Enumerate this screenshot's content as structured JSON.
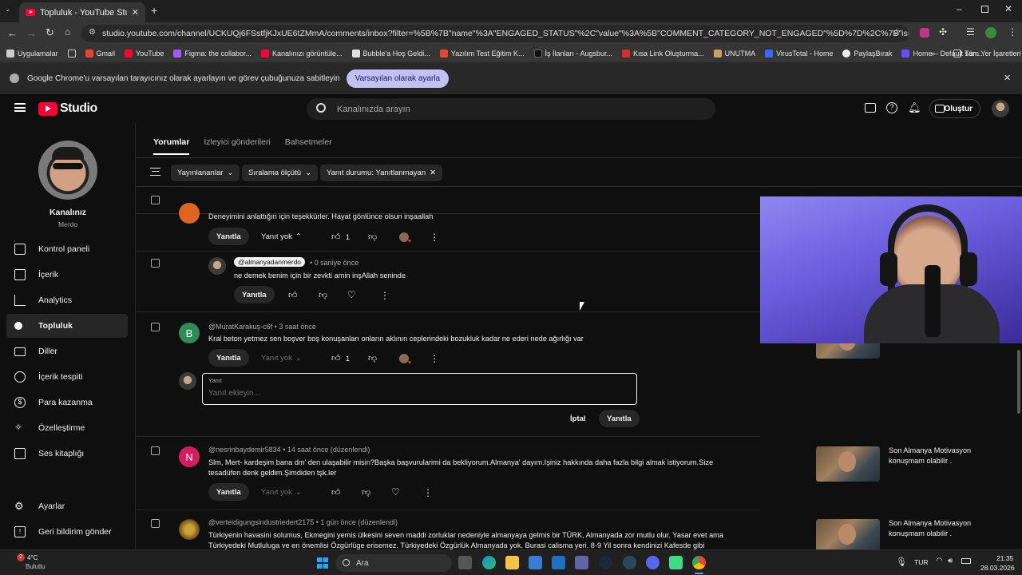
{
  "browser": {
    "tab_title": "Topluluk - YouTube Studio",
    "url": "studio.youtube.com/channel/UCKUQj6FSstfjKJxUE6tZMmA/comments/inbox?filter=%5B%7B\"name\"%3A\"ENGAGED_STATUS\"%2C\"value\"%3A%5B\"COMMENT_CATEGORY_NOT_ENGAGED\"%5D%7D%2C%7B\"isPinned\"%3Atrue%2C\"name\"...",
    "bookmarks": [
      {
        "label": "Uygulamalar",
        "color": "#e0e0e0"
      },
      {
        "label": "Gmail",
        "color": "#ea4335"
      },
      {
        "label": "YouTube",
        "color": "#ff0033"
      },
      {
        "label": "Figma: the collabor...",
        "color": "#a259ff"
      },
      {
        "label": "Kanalınızı görüntüle...",
        "color": "#ff0033"
      },
      {
        "label": "Bubble'a Hoş Geldi...",
        "color": "#e0e0e0"
      },
      {
        "label": "Yazılım Test Eğitim K...",
        "color": "#e34a2f"
      },
      {
        "label": "İş İlanları - Augsbur...",
        "color": "#1a1a1a"
      },
      {
        "label": "Kısa Link Oluşturma...",
        "color": "#d32f2f"
      },
      {
        "label": "UNUTMA",
        "color": "#c8a165"
      },
      {
        "label": "VirusTotal - Home",
        "color": "#3a66ff"
      },
      {
        "label": "PaylaşBırak",
        "color": "#f0f0f0"
      },
      {
        "label": "Home – Default san...",
        "color": "#6a4cff"
      }
    ],
    "bookmarks_all": "Tüm Yer İşaretleri",
    "infobar_text": "Google Chrome'u varsayılan tarayıcınız olarak ayarlayın ve görev çubuğunuza sabitleyin",
    "infobar_button": "Varsayılan olarak ayarla"
  },
  "studio": {
    "logo": "Studio",
    "search_placeholder": "Kanalınızda arayın",
    "create_label": "Oluştur",
    "channel_title": "Kanalınız",
    "channel_name": "Merdo",
    "nav": [
      {
        "label": "Kontrol paneli",
        "icon": "dashboard-icon"
      },
      {
        "label": "İçerik",
        "icon": "content-icon"
      },
      {
        "label": "Analytics",
        "icon": "analytics-icon"
      },
      {
        "label": "Topluluk",
        "icon": "community-icon"
      },
      {
        "label": "Diller",
        "icon": "subtitles-icon"
      },
      {
        "label": "İçerik tespiti",
        "icon": "copyright-icon"
      },
      {
        "label": "Para kazanma",
        "icon": "dollar-icon"
      },
      {
        "label": "Özelleştirme",
        "icon": "wand-icon"
      },
      {
        "label": "Ses kitaplığı",
        "icon": "audio-library-icon"
      }
    ],
    "settings_label": "Ayarlar",
    "feedback_label": "Geri bildirim gönder",
    "tabs": [
      "Yorumlar",
      "İzleyici gönderileri",
      "Bahsetmeler"
    ],
    "filters": [
      "Yayınlananlar",
      "Sıralama ölçütü",
      "Yanıt durumu: Yanıtlanmayan"
    ],
    "comments": {
      "c0_text": "Deneyimini anlattığın için teşekkürler. Hayat gönlünce olsun inşaallah",
      "c0_likes": "1",
      "reply_label": "Yanıtla",
      "no_reply_label": "Yanıt yok",
      "r1_author": "@almanyadanmerdo",
      "r1_time": "0 saniye önce",
      "r1_text": "ne demek benim için bir zevkti amin inşAllah seninde",
      "c2_initial": "B",
      "c2_author": "@MuratKarakuş-c6f",
      "c2_time": "3 saat önce",
      "c2_text": "Kral beton yetmez sen boşver boş konuşanları onların aklının ceplerindeki bozukluk kadar ne ederi nede ağırlığı var",
      "c2_likes": "1",
      "reply_box_label": "Yanıt",
      "reply_box_placeholder": "Yanıt ekleyin...",
      "cancel_label": "İptal",
      "submit_label": "Yanıtla",
      "c3_initial": "N",
      "c3_author": "@nesrinbaydemir5834",
      "c3_time": "14 saat önce (düzenlendi)",
      "c3_text1": "Slm, Mert- kardeşim bana dm' den ulaşabilir misin?Başka başvurularimi da bekliyorum.Almanya' dayım.Işiniz hakkında daha fazla bilgi almak istiyorum.Size",
      "c3_text2": "tesadüfen denk geldim.Şimdiden tşk.ler",
      "c4_author": "@verteidigungsindustriedert2175",
      "c4_time": "1 gün önce (düzenlendi)",
      "c4_text1": "Türkiyenin havasini solumus, Ekmegini yemis ülkesini seven maddi zorluklar nedeniyle almanyaya gelmis  bir TÜRK, Almanyada zor mutlu olur. Yasar evet ama",
      "c4_text2": "Türkiyedeki Mutluluga ve en önemlisi Özgürlüge erisemez. Türkiyedeki Özgürlük Almanyada yok. Burasi calisma yeri. 8-9 Yil sonra kendinizi Kafesde gibi",
      "video_title": "Son Almanya Motivasyon konuşmam olabilir ."
    }
  },
  "taskbar": {
    "weather_temp": "4°C",
    "weather_text": "Bulutlu",
    "weather_badge": "2",
    "search_label": "Ara",
    "lang": "TUR",
    "time": "21:35",
    "date": "28.03.2026"
  }
}
